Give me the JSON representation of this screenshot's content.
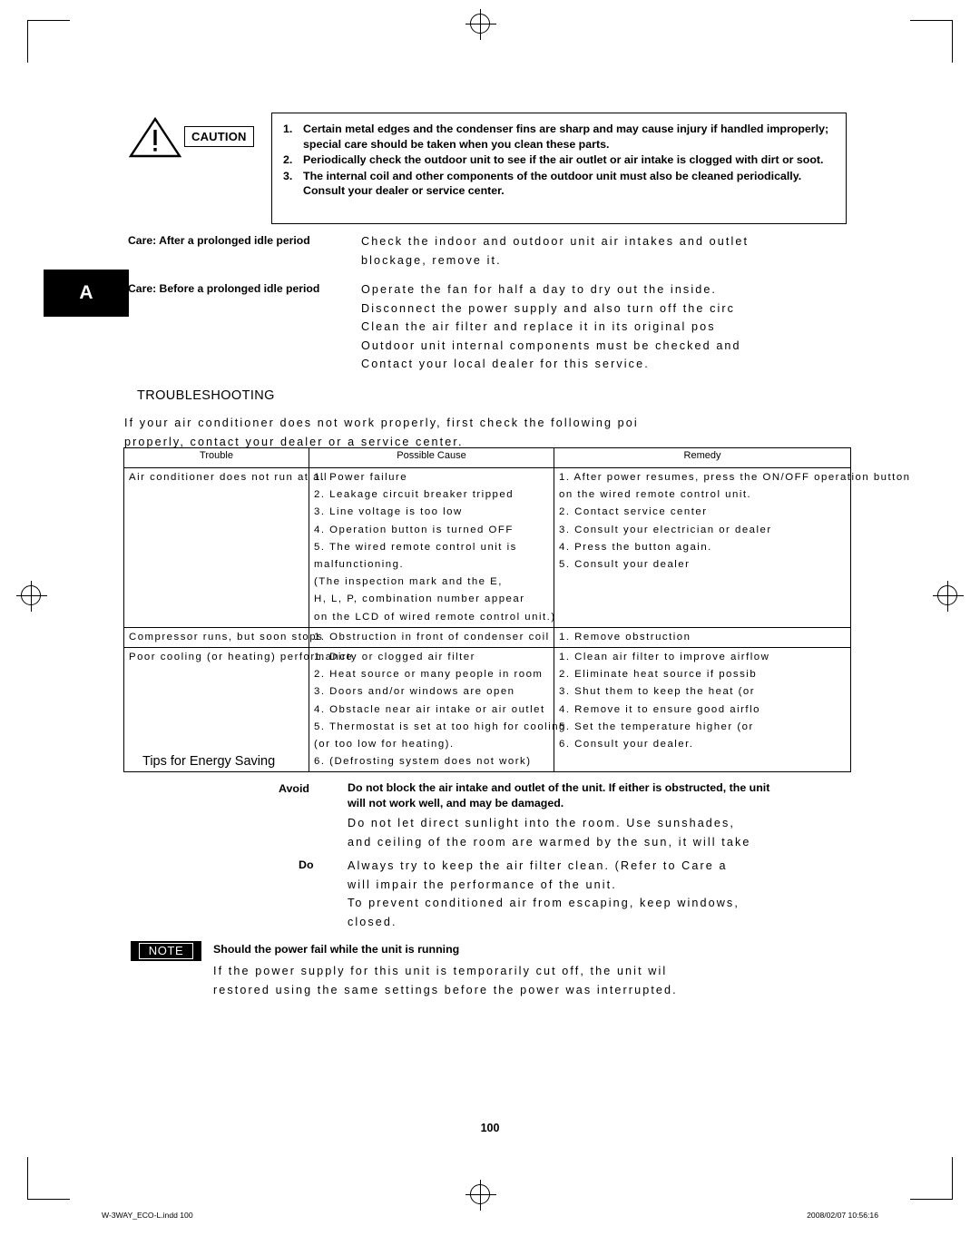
{
  "caution": {
    "label": "CAUTION",
    "items": [
      {
        "num": "1.",
        "text": "Certain metal edges and the condenser fins are sharp and may cause injury if handled improperly; special care should be taken when you clean these parts."
      },
      {
        "num": "2.",
        "text": "Periodically check the outdoor unit to see if the air outlet or air intake is clogged with dirt or soot."
      },
      {
        "num": "3.",
        "text": "The internal coil and other components of the outdoor unit must also be cleaned periodically. Consult your dealer or service center."
      }
    ]
  },
  "tab": {
    "letter": "A"
  },
  "care": {
    "after_label": "Care: After a prolonged idle period",
    "after_lines": [
      "Check the indoor and outdoor unit air intakes and outlet",
      "blockage, remove it."
    ],
    "before_label": "Care: Before a prolonged idle period",
    "before_lines": [
      "Operate the fan for half a day to dry out the inside.",
      "Disconnect the power supply and also turn off the circ",
      "Clean the air filter and replace it in its original pos",
      "Outdoor unit internal components must be checked and",
      "Contact your local dealer for this service."
    ]
  },
  "troubleshooting": {
    "title": "TROUBLESHOOTING",
    "intro_lines": [
      "If your air conditioner does not work properly, first check the following poi",
      "properly, contact your dealer or a service center."
    ],
    "headers": [
      "Trouble",
      "Possible Cause",
      "Remedy"
    ],
    "rows": [
      {
        "trouble": [
          "Air conditioner does not run at all"
        ],
        "cause": [
          "1. Power failure",
          "2. Leakage circuit breaker tripped",
          "3. Line voltage is too low",
          "4. Operation button is turned OFF",
          "5. The wired remote control unit is",
          "   malfunctioning.",
          "   (The inspection mark and the E,",
          "   H, L, P, combination number appear",
          "   on the LCD of wired remote control unit.)"
        ],
        "remedy": [
          "1. After power resumes, press the ON/OFF operation button",
          "   on the wired remote control unit.",
          "2. Contact service center",
          "3. Consult your electrician or dealer",
          "4. Press the button again.",
          "5. Consult your dealer"
        ]
      },
      {
        "trouble": [
          "Compressor runs, but soon stops"
        ],
        "cause": [
          "1. Obstruction in front of condenser coil"
        ],
        "remedy": [
          "1. Remove obstruction"
        ]
      },
      {
        "trouble": [
          "Poor cooling (or heating) performance"
        ],
        "cause": [
          "1. Dirty or clogged air filter",
          "2. Heat source or many people in room",
          "3. Doors and/or windows are open",
          "4. Obstacle near air intake or air outlet",
          "5. Thermostat is set at too high for cooling",
          "   (or too low for heating).",
          "6. (Defrosting system does not work)"
        ],
        "remedy": [
          "1. Clean air filter to improve airflow",
          "2. Eliminate heat source if possib",
          "3. Shut them to keep the heat (or",
          "4. Remove it to ensure good airflo",
          "5. Set the temperature higher (or",
          "6. Consult your dealer."
        ]
      }
    ]
  },
  "tips": {
    "title": "Tips for Energy Saving",
    "avoid_label": "Avoid",
    "avoid_bold_lines": [
      "Do not block the air intake and outlet of the unit. If either is obstructed, the unit",
      "will not work well, and may be damaged."
    ],
    "avoid_spaced_lines": [
      "Do not let direct sunlight into the room. Use sunshades,",
      "and ceiling of the room are warmed by the sun, it will take"
    ],
    "do_label": "Do",
    "do_spaced_lines": [
      "Always try to keep the air filter clean. (Refer to  Care a",
      "will impair the performance of the unit.",
      "To prevent conditioned air from escaping, keep windows,",
      "closed."
    ]
  },
  "note": {
    "badge": "NOTE",
    "title": "Should the power fail while the unit is running",
    "body_lines": [
      "If the power supply for this unit is temporarily cut off, the unit wil",
      "restored using the same settings before the power was interrupted."
    ]
  },
  "page_number": "100",
  "footer": {
    "left": "W-3WAY_ECO-L.indd   100",
    "right": "2008/02/07   10:56:16"
  }
}
